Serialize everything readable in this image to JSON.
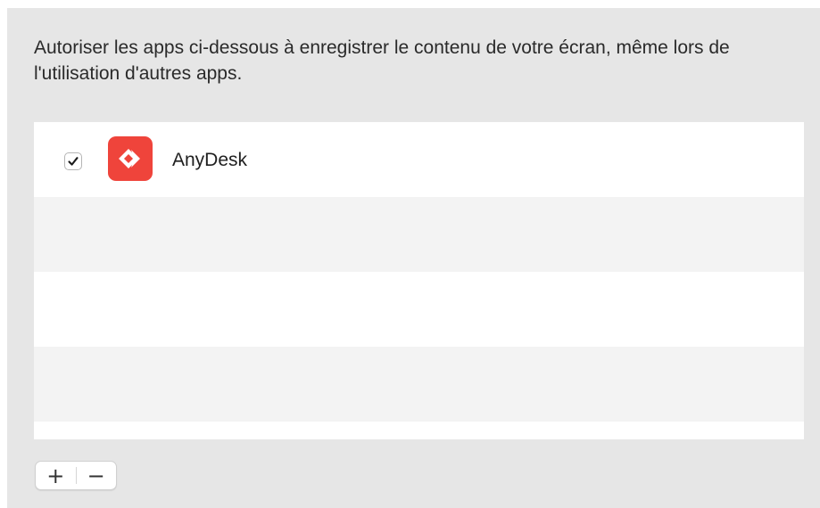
{
  "description": "Autoriser les apps ci-dessous à enregistrer le contenu de votre écran, même lors de l'utilisation d'autres apps.",
  "apps": [
    {
      "name": "AnyDesk",
      "checked": true,
      "icon": "anydesk-icon",
      "icon_color": "#ef443b"
    }
  ],
  "controls": {
    "add_label": "+",
    "remove_label": "−"
  }
}
